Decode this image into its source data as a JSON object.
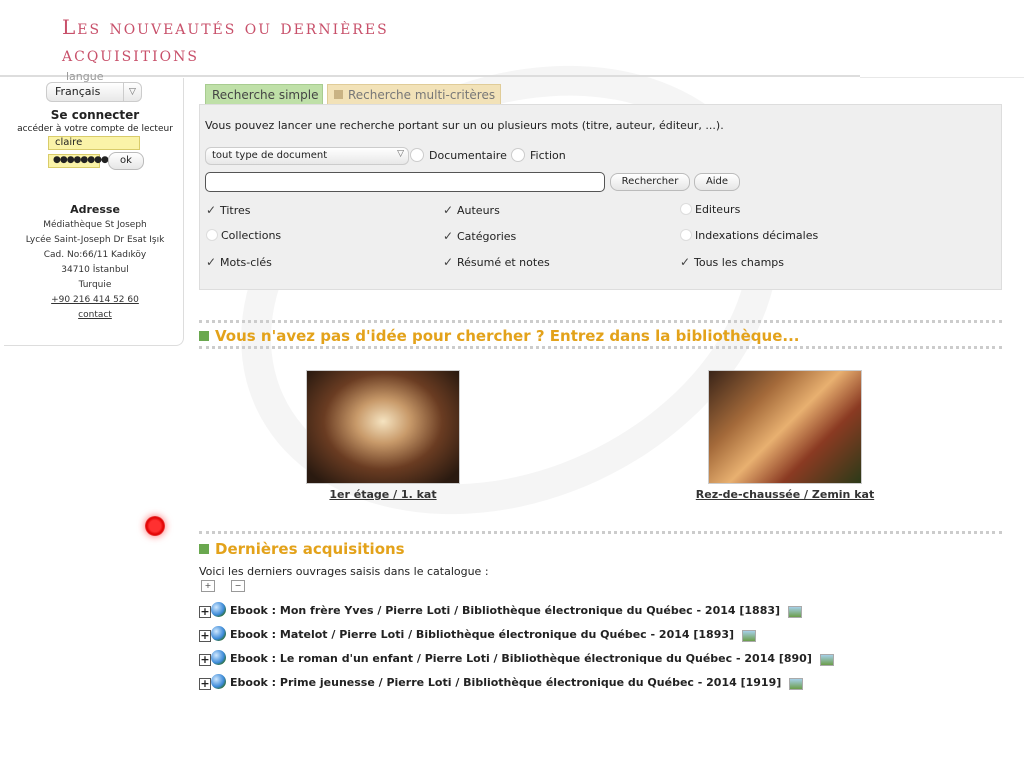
{
  "page_title": [
    "Les nouveautés ou dernières",
    "acquisitions"
  ],
  "sidebar": {
    "lang_heading": "langue",
    "lang_selected": "Français",
    "login_title": "Se connecter",
    "login_sub": "accéder à votre compte de lecteur",
    "login_value": "claire",
    "password_mask": "●●●●●●●●",
    "ok_label": "ok",
    "address_title": "Adresse",
    "address_lines": [
      "Médiathèque St Joseph",
      "Lycée Saint-Joseph Dr Esat Işık",
      "Cad. No:66/11 Kadıköy",
      "34710 İstanbul",
      "Turquie"
    ],
    "phone": "+90 216 414 52 60",
    "contact": "contact"
  },
  "search": {
    "tab_simple": "Recherche simple",
    "tab_multi": "Recherche multi-critères",
    "intro": "Vous pouvez lancer une recherche portant sur un ou plusieurs mots (titre, auteur, éditeur, ...).",
    "doctype_selected": "tout type de document",
    "filter_1": "Documentaire",
    "filter_2": "Fiction",
    "search_button": "Rechercher",
    "help_button": "Aide",
    "criteria": [
      {
        "label": "Titres",
        "checked": true
      },
      {
        "label": "Auteurs",
        "checked": true
      },
      {
        "label": "Editeurs",
        "checked": false
      },
      {
        "label": "Collections",
        "checked": false
      },
      {
        "label": "Catégories",
        "checked": true
      },
      {
        "label": "Indexations décimales",
        "checked": false
      },
      {
        "label": "Mots-clés",
        "checked": true
      },
      {
        "label": "Résumé et notes",
        "checked": true
      },
      {
        "label": "Tous les champs",
        "checked": true
      }
    ]
  },
  "library": {
    "heading": "Vous n'avez pas d'idée pour chercher ? Entrez dans la bibliothèque...",
    "floor_1": "1er étage / 1. kat",
    "floor_0": "Rez-de-chaussée / Zemin kat"
  },
  "acquisitions": {
    "heading": "Dernières acquisitions",
    "intro": "Voici les derniers ouvrages saisis dans le catalogue :",
    "items": [
      "Ebook : Mon frère Yves / Pierre Loti / Bibliothèque électronique du Québec - 2014 [1883]",
      "Ebook : Matelot / Pierre Loti / Bibliothèque électronique du Québec - 2014 [1893]",
      "Ebook : Le roman d'un enfant / Pierre Loti / Bibliothèque électronique du Québec - 2014 [890]",
      "Ebook : Prime jeunesse / Pierre Loti / Bibliothèque électronique du Québec - 2014 [1919]"
    ]
  },
  "colors": {
    "title": "#c8506a",
    "heading": "#e3a21a",
    "section_square": "#6aa84f",
    "cursor_marker": "#ff2020"
  },
  "icons": [
    "expand-all-icon",
    "collapse-all-icon",
    "plus-icon",
    "globe-icon",
    "thumbnail-icon",
    "checkmark-icon"
  ]
}
